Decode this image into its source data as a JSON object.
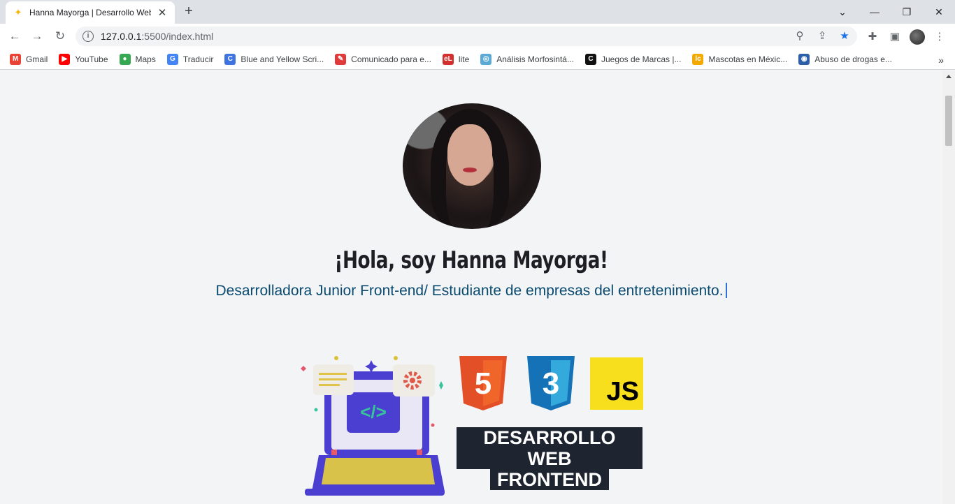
{
  "browser": {
    "tab_title": "Hanna Mayorga | Desarrollo Web",
    "url_host": "127.0.0.1",
    "url_path": ":5500/index.html",
    "bookmarks": [
      {
        "label": "Gmail",
        "icon": "gmail-icon",
        "color": "#ea4335",
        "glyph": "M"
      },
      {
        "label": "YouTube",
        "icon": "youtube-icon",
        "color": "#ff0000",
        "glyph": "▶"
      },
      {
        "label": "Maps",
        "icon": "maps-icon",
        "color": "#34a853",
        "glyph": "●"
      },
      {
        "label": "Traducir",
        "icon": "translate-icon",
        "color": "#4285f4",
        "glyph": "G"
      },
      {
        "label": "Blue and Yellow Scri...",
        "icon": "canva-icon",
        "color": "#3d74e0",
        "glyph": "C"
      },
      {
        "label": "Comunicado para e...",
        "icon": "feather-icon",
        "color": "#e03a3a",
        "glyph": "✎"
      },
      {
        "label": "lite",
        "icon": "el-icon",
        "color": "#d32f2f",
        "glyph": "eL"
      },
      {
        "label": "Análisis Morfosintá...",
        "icon": "globe-icon",
        "color": "#5aa9d6",
        "glyph": "◎"
      },
      {
        "label": "Juegos de Marcas |...",
        "icon": "c-icon",
        "color": "#111111",
        "glyph": "C"
      },
      {
        "label": "Mascotas en Méxic...",
        "icon": "lc-icon",
        "color": "#f2a900",
        "glyph": "lc"
      },
      {
        "label": "Abuso de drogas e...",
        "icon": "un-icon",
        "color": "#2d5fa8",
        "glyph": "◉"
      }
    ]
  },
  "page": {
    "greeting": "¡Hola, soy Hanna Mayorga!",
    "subtitle": "Desarrolladora Junior Front-end/ Estudiante de empresas del entretenimiento.",
    "banner_line1": "DESARROLLO WEB",
    "banner_line2": "FRONTEND",
    "html_badge": "5",
    "css_badge": "3",
    "js_badge": "JS",
    "code_glyph": "</>"
  },
  "colors": {
    "html": "#e34f26",
    "css": "#1572b6",
    "js": "#f7df1e",
    "laptop": "#4a3fd1",
    "accent_star": "#4a3fd1"
  }
}
